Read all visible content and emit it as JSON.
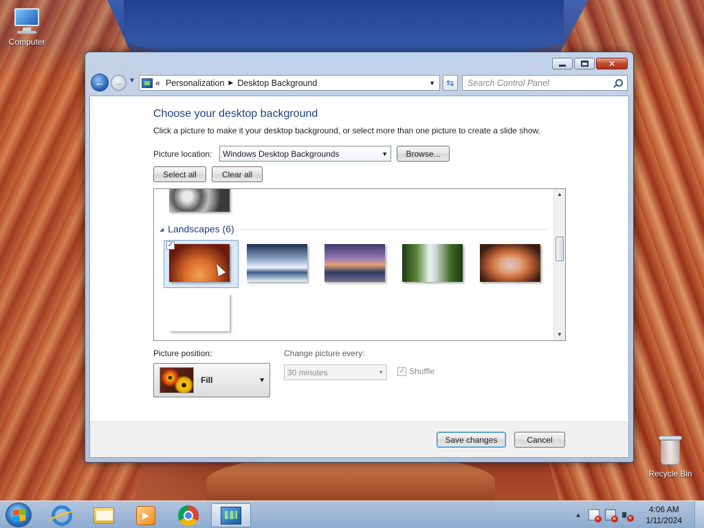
{
  "desktop": {
    "computer_label": "Computer",
    "recycle_bin_label": "Recycle Bin"
  },
  "window": {
    "caption": {
      "close_glyph": "✕"
    },
    "nav": {
      "back_glyph": "←",
      "forward_glyph": "→",
      "address": {
        "crumb_prefix": "«",
        "crumbs": [
          "Personalization",
          "Desktop Background"
        ]
      },
      "refresh_glyph": "⇆",
      "search_placeholder": "Search Control Panel"
    },
    "heading": "Choose your desktop background",
    "description": "Click a picture to make it your desktop background, or select more than one picture to create a slide show.",
    "picture_location": {
      "label": "Picture location:",
      "value": "Windows Desktop Backgrounds",
      "browse_label": "Browse..."
    },
    "select_all_label": "Select all",
    "clear_all_label": "Clear all",
    "gallery": {
      "group_title": "Landscapes (6)",
      "selected_index": 0,
      "thumbnails": [
        {
          "name": "canyon-waves",
          "selected": true,
          "colors": [
            "#6a1c0c",
            "#d86a2a",
            "#f2a354"
          ]
        },
        {
          "name": "iceberg-lake",
          "selected": false,
          "colors": [
            "#1c2d4f",
            "#8da7c9",
            "#eef3fa"
          ]
        },
        {
          "name": "sunset-coast",
          "selected": false,
          "colors": [
            "#3b3a6d",
            "#9b7db6",
            "#e7a070"
          ]
        },
        {
          "name": "waterfall",
          "selected": false,
          "colors": [
            "#1d3a14",
            "#5f8a3a",
            "#e8f0f0"
          ]
        },
        {
          "name": "rock-arch",
          "selected": false,
          "colors": [
            "#3e1c12",
            "#c86a3a",
            "#d9c6c8"
          ]
        },
        {
          "name": "lavender-field",
          "selected": false,
          "colors": [
            "#c8c1df",
            "#8d6fa8",
            "#4e3368"
          ]
        }
      ],
      "checkmark": "✓"
    },
    "picture_position": {
      "label": "Picture position:",
      "value": "Fill"
    },
    "change_every": {
      "label": "Change picture every:",
      "value": "30 minutes"
    },
    "shuffle": {
      "label": "Shuffle",
      "checked": true,
      "checkmark": "✓"
    },
    "save_label": "Save changes",
    "cancel_label": "Cancel"
  },
  "taskbar": {
    "pinned": [
      "internet-explorer",
      "windows-explorer",
      "media-player",
      "chrome",
      "control-panel"
    ],
    "active": "control-panel",
    "clock": {
      "time": "4:06 AM",
      "date": "1/11/2024"
    }
  },
  "colors": {
    "heading": "#1e3f84",
    "accent_blue": "#1d5fb4",
    "close_red": "#c7452b"
  }
}
